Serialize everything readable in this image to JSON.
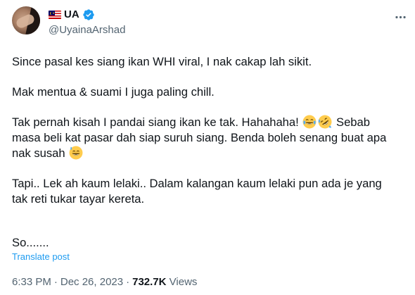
{
  "user": {
    "display_name": "UA",
    "handle": "@UyainaArshad",
    "flag_icon": "malaysia-flag-icon",
    "verified_icon": "verified-badge-icon",
    "verified_color": "#1d9bf0"
  },
  "tweet": {
    "paragraphs": [
      {
        "lines": [
          "Since pasal kes siang ikan WHI viral, I nak cakap lah sikit."
        ]
      },
      {
        "lines": [
          "Mak mentua & suami I juga paling chill."
        ]
      },
      {
        "line1_text": "Tak pernah kisah I pandai siang ikan ke tak. Hahahaha!",
        "line1_tail": "Sebab",
        "line2": "masa beli kat pasar dah siap suruh siang. Benda boleh senang buat apa",
        "line3": "nak susah"
      },
      {
        "lines": [
          "Tapi.. Lek ah kaum lelaki.. Dalam kalangan kaum lelaki pun ada je yang",
          "tak reti tukar tayar kereta."
        ]
      },
      {
        "lines": [
          "So......."
        ]
      }
    ],
    "emojis": [
      "face-with-tears-of-joy-icon",
      "rolling-on-the-floor-laughing-icon",
      "grinning-face-with-sweat-icon"
    ]
  },
  "translate_label": "Translate post",
  "meta": {
    "time": "6:33 PM",
    "separator": "·",
    "date": "Dec 26, 2023",
    "views_count": "732.7K",
    "views_label": "Views"
  },
  "colors": {
    "text": "#0f1419",
    "secondary": "#536471",
    "accent": "#1d9bf0"
  }
}
